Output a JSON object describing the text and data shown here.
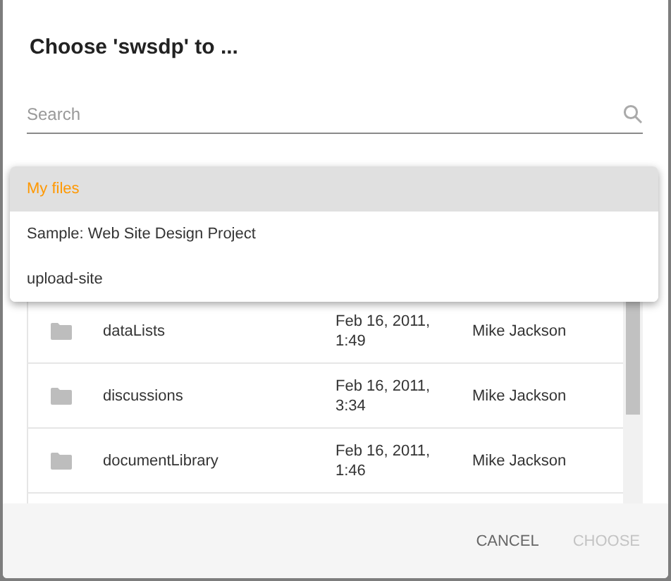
{
  "dialog": {
    "title": "Choose 'swsdp' to ...",
    "search": {
      "placeholder": "Search"
    },
    "menu": [
      {
        "label": "My files",
        "selected": true
      },
      {
        "label": "Sample: Web Site Design Project",
        "selected": false
      },
      {
        "label": "upload-site",
        "selected": false
      }
    ],
    "rows": [
      {
        "name": "dataLists",
        "modified": "Feb 16, 2011, 1:49",
        "modifier": "Mike Jackson"
      },
      {
        "name": "discussions",
        "modified": "Feb 16, 2011, 3:34",
        "modifier": "Mike Jackson"
      },
      {
        "name": "documentLibrary",
        "modified": "Feb 16, 2011, 1:46",
        "modifier": "Mike Jackson"
      }
    ],
    "buttons": [
      {
        "label": "CANCEL",
        "disabled": false
      },
      {
        "label": "CHOOSE",
        "disabled": true
      }
    ]
  }
}
